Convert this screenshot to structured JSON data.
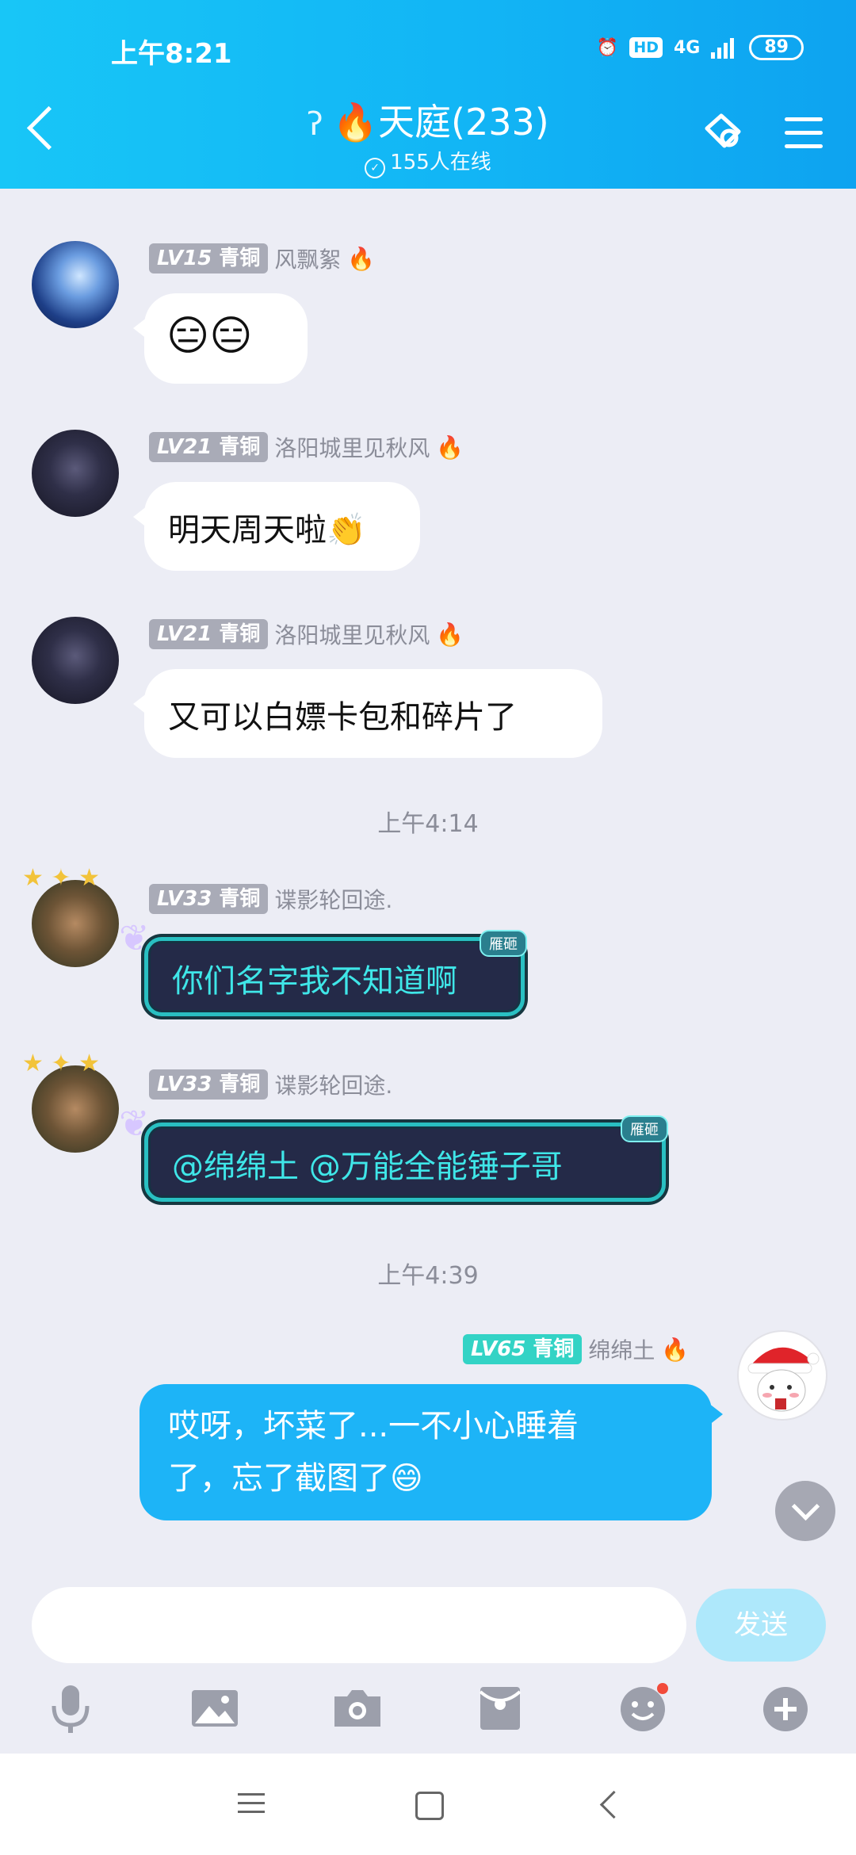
{
  "status_bar": {
    "time": "上午8:21",
    "network": "4G",
    "hd": "HD",
    "battery": "89"
  },
  "header": {
    "title": "天庭(233)",
    "title_emoji": "🔥",
    "online": "155人在线"
  },
  "messages": [
    {
      "level": "LV15",
      "rank": "青铜",
      "name": "风飘絮",
      "text": "😑😑"
    },
    {
      "level": "LV21",
      "rank": "青铜",
      "name": "洛阳城里见秋风",
      "text": "明天周天啦👏"
    },
    {
      "level": "LV21",
      "rank": "青铜",
      "name": "洛阳城里见秋风",
      "text": "又可以白嫖卡包和碎片了"
    },
    {
      "level": "LV33",
      "rank": "青铜",
      "name": "谍影轮回途.",
      "text": "你们名字我不知道啊",
      "tag": "雁砸"
    },
    {
      "level": "LV33",
      "rank": "青铜",
      "name": "谍影轮回途.",
      "text": "@绵绵土  @万能全能锤子哥",
      "tag": "雁砸"
    },
    {
      "level": "LV65",
      "rank": "青铜",
      "name": "绵绵土",
      "text_line1": "哎呀，坏菜了...一不小心睡着",
      "text_line2": "了，忘了截图了😄"
    }
  ],
  "time_separators": [
    "上午4:14",
    "上午4:39"
  ],
  "input": {
    "placeholder": "",
    "send_label": "发送"
  },
  "icons": [
    "ear-icon",
    "verify-icon",
    "settings-icon",
    "menu-icon",
    "microphone-icon",
    "image-icon",
    "camera-icon",
    "red-packet-icon",
    "emoji-icon",
    "plus-icon"
  ],
  "colors": {
    "header": "#12b5f5",
    "my_bubble": "#1db4f7",
    "background": "#ecedf5"
  }
}
